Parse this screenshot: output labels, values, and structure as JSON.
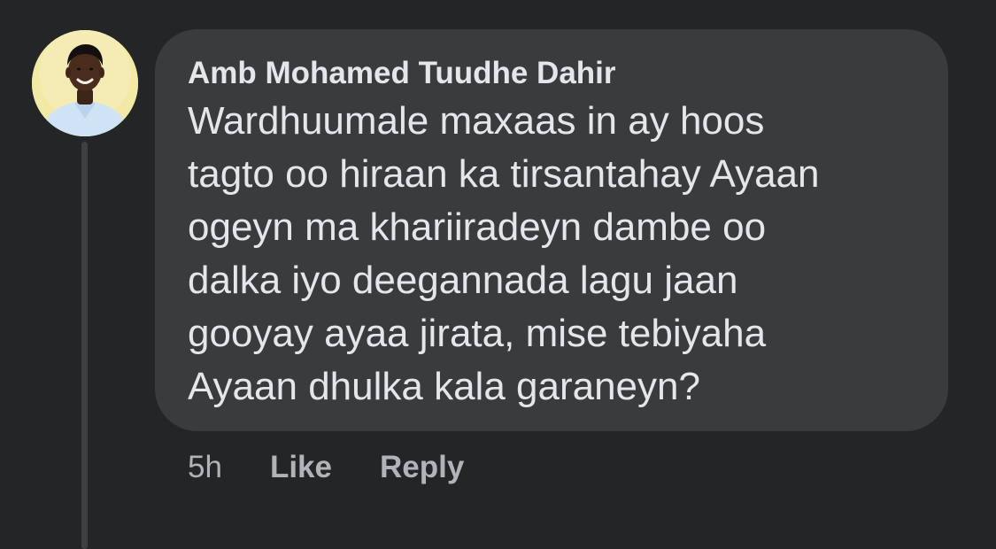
{
  "comment": {
    "author": "Amb Mohamed Tuudhe Dahir",
    "text_lines": [
      "Wardhuumale maxaas in ay hoos",
      "tagto oo hiraan ka tirsantahay Ayaan",
      "ogeyn ma khariiradeyn dambe oo",
      "dalka iyo deegannada lagu jaan",
      "gooyay ayaa jirata, mise tebiyaha",
      "Ayaan dhulka kala garaneyn?"
    ],
    "timestamp": "5h",
    "like_label": "Like",
    "reply_label": "Reply"
  },
  "colors": {
    "background": "#242526",
    "bubble": "#3a3b3c",
    "primary_text": "#e4e6eb",
    "secondary_text": "#b0b3b8"
  },
  "icons": {
    "avatar": "user-avatar-photo"
  }
}
